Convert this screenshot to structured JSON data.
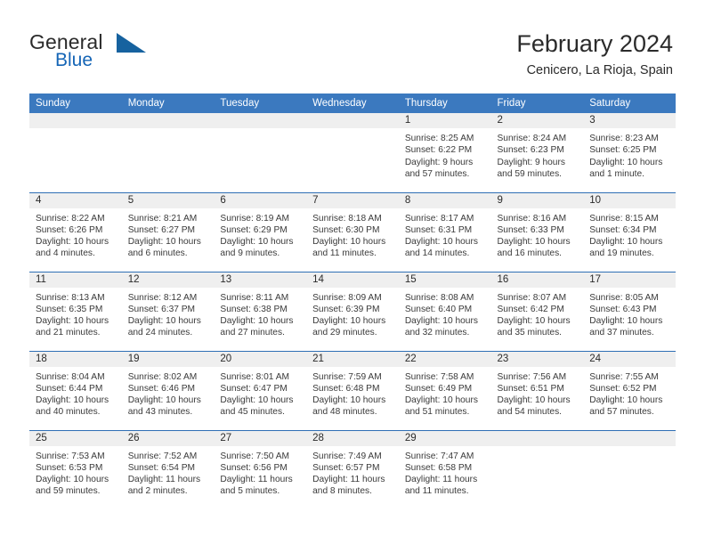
{
  "brand": {
    "name_top": "General",
    "name_bottom": "Blue",
    "logo_icon": "triangle-flag-icon",
    "accent_color": "#16629f"
  },
  "header": {
    "title": "February 2024",
    "location": "Cenicero, La Rioja, Spain"
  },
  "theme": {
    "header_blue": "#3b79bf",
    "row_divider_blue": "#2f6fb5",
    "daynum_band": "#efefef",
    "text": "#2b2b2b"
  },
  "weekday_headers": [
    "Sunday",
    "Monday",
    "Tuesday",
    "Wednesday",
    "Thursday",
    "Friday",
    "Saturday"
  ],
  "weeks": [
    [
      {
        "day": "",
        "empty": true,
        "sunrise": "",
        "sunset": "",
        "daylight_1": "",
        "daylight_2": ""
      },
      {
        "day": "",
        "empty": true,
        "sunrise": "",
        "sunset": "",
        "daylight_1": "",
        "daylight_2": ""
      },
      {
        "day": "",
        "empty": true,
        "sunrise": "",
        "sunset": "",
        "daylight_1": "",
        "daylight_2": ""
      },
      {
        "day": "",
        "empty": true,
        "sunrise": "",
        "sunset": "",
        "daylight_1": "",
        "daylight_2": ""
      },
      {
        "day": "1",
        "empty": false,
        "sunrise": "Sunrise: 8:25 AM",
        "sunset": "Sunset: 6:22 PM",
        "daylight_1": "Daylight: 9 hours",
        "daylight_2": "and 57 minutes."
      },
      {
        "day": "2",
        "empty": false,
        "sunrise": "Sunrise: 8:24 AM",
        "sunset": "Sunset: 6:23 PM",
        "daylight_1": "Daylight: 9 hours",
        "daylight_2": "and 59 minutes."
      },
      {
        "day": "3",
        "empty": false,
        "sunrise": "Sunrise: 8:23 AM",
        "sunset": "Sunset: 6:25 PM",
        "daylight_1": "Daylight: 10 hours",
        "daylight_2": "and 1 minute."
      }
    ],
    [
      {
        "day": "4",
        "empty": false,
        "sunrise": "Sunrise: 8:22 AM",
        "sunset": "Sunset: 6:26 PM",
        "daylight_1": "Daylight: 10 hours",
        "daylight_2": "and 4 minutes."
      },
      {
        "day": "5",
        "empty": false,
        "sunrise": "Sunrise: 8:21 AM",
        "sunset": "Sunset: 6:27 PM",
        "daylight_1": "Daylight: 10 hours",
        "daylight_2": "and 6 minutes."
      },
      {
        "day": "6",
        "empty": false,
        "sunrise": "Sunrise: 8:19 AM",
        "sunset": "Sunset: 6:29 PM",
        "daylight_1": "Daylight: 10 hours",
        "daylight_2": "and 9 minutes."
      },
      {
        "day": "7",
        "empty": false,
        "sunrise": "Sunrise: 8:18 AM",
        "sunset": "Sunset: 6:30 PM",
        "daylight_1": "Daylight: 10 hours",
        "daylight_2": "and 11 minutes."
      },
      {
        "day": "8",
        "empty": false,
        "sunrise": "Sunrise: 8:17 AM",
        "sunset": "Sunset: 6:31 PM",
        "daylight_1": "Daylight: 10 hours",
        "daylight_2": "and 14 minutes."
      },
      {
        "day": "9",
        "empty": false,
        "sunrise": "Sunrise: 8:16 AM",
        "sunset": "Sunset: 6:33 PM",
        "daylight_1": "Daylight: 10 hours",
        "daylight_2": "and 16 minutes."
      },
      {
        "day": "10",
        "empty": false,
        "sunrise": "Sunrise: 8:15 AM",
        "sunset": "Sunset: 6:34 PM",
        "daylight_1": "Daylight: 10 hours",
        "daylight_2": "and 19 minutes."
      }
    ],
    [
      {
        "day": "11",
        "empty": false,
        "sunrise": "Sunrise: 8:13 AM",
        "sunset": "Sunset: 6:35 PM",
        "daylight_1": "Daylight: 10 hours",
        "daylight_2": "and 21 minutes."
      },
      {
        "day": "12",
        "empty": false,
        "sunrise": "Sunrise: 8:12 AM",
        "sunset": "Sunset: 6:37 PM",
        "daylight_1": "Daylight: 10 hours",
        "daylight_2": "and 24 minutes."
      },
      {
        "day": "13",
        "empty": false,
        "sunrise": "Sunrise: 8:11 AM",
        "sunset": "Sunset: 6:38 PM",
        "daylight_1": "Daylight: 10 hours",
        "daylight_2": "and 27 minutes."
      },
      {
        "day": "14",
        "empty": false,
        "sunrise": "Sunrise: 8:09 AM",
        "sunset": "Sunset: 6:39 PM",
        "daylight_1": "Daylight: 10 hours",
        "daylight_2": "and 29 minutes."
      },
      {
        "day": "15",
        "empty": false,
        "sunrise": "Sunrise: 8:08 AM",
        "sunset": "Sunset: 6:40 PM",
        "daylight_1": "Daylight: 10 hours",
        "daylight_2": "and 32 minutes."
      },
      {
        "day": "16",
        "empty": false,
        "sunrise": "Sunrise: 8:07 AM",
        "sunset": "Sunset: 6:42 PM",
        "daylight_1": "Daylight: 10 hours",
        "daylight_2": "and 35 minutes."
      },
      {
        "day": "17",
        "empty": false,
        "sunrise": "Sunrise: 8:05 AM",
        "sunset": "Sunset: 6:43 PM",
        "daylight_1": "Daylight: 10 hours",
        "daylight_2": "and 37 minutes."
      }
    ],
    [
      {
        "day": "18",
        "empty": false,
        "sunrise": "Sunrise: 8:04 AM",
        "sunset": "Sunset: 6:44 PM",
        "daylight_1": "Daylight: 10 hours",
        "daylight_2": "and 40 minutes."
      },
      {
        "day": "19",
        "empty": false,
        "sunrise": "Sunrise: 8:02 AM",
        "sunset": "Sunset: 6:46 PM",
        "daylight_1": "Daylight: 10 hours",
        "daylight_2": "and 43 minutes."
      },
      {
        "day": "20",
        "empty": false,
        "sunrise": "Sunrise: 8:01 AM",
        "sunset": "Sunset: 6:47 PM",
        "daylight_1": "Daylight: 10 hours",
        "daylight_2": "and 45 minutes."
      },
      {
        "day": "21",
        "empty": false,
        "sunrise": "Sunrise: 7:59 AM",
        "sunset": "Sunset: 6:48 PM",
        "daylight_1": "Daylight: 10 hours",
        "daylight_2": "and 48 minutes."
      },
      {
        "day": "22",
        "empty": false,
        "sunrise": "Sunrise: 7:58 AM",
        "sunset": "Sunset: 6:49 PM",
        "daylight_1": "Daylight: 10 hours",
        "daylight_2": "and 51 minutes."
      },
      {
        "day": "23",
        "empty": false,
        "sunrise": "Sunrise: 7:56 AM",
        "sunset": "Sunset: 6:51 PM",
        "daylight_1": "Daylight: 10 hours",
        "daylight_2": "and 54 minutes."
      },
      {
        "day": "24",
        "empty": false,
        "sunrise": "Sunrise: 7:55 AM",
        "sunset": "Sunset: 6:52 PM",
        "daylight_1": "Daylight: 10 hours",
        "daylight_2": "and 57 minutes."
      }
    ],
    [
      {
        "day": "25",
        "empty": false,
        "sunrise": "Sunrise: 7:53 AM",
        "sunset": "Sunset: 6:53 PM",
        "daylight_1": "Daylight: 10 hours",
        "daylight_2": "and 59 minutes."
      },
      {
        "day": "26",
        "empty": false,
        "sunrise": "Sunrise: 7:52 AM",
        "sunset": "Sunset: 6:54 PM",
        "daylight_1": "Daylight: 11 hours",
        "daylight_2": "and 2 minutes."
      },
      {
        "day": "27",
        "empty": false,
        "sunrise": "Sunrise: 7:50 AM",
        "sunset": "Sunset: 6:56 PM",
        "daylight_1": "Daylight: 11 hours",
        "daylight_2": "and 5 minutes."
      },
      {
        "day": "28",
        "empty": false,
        "sunrise": "Sunrise: 7:49 AM",
        "sunset": "Sunset: 6:57 PM",
        "daylight_1": "Daylight: 11 hours",
        "daylight_2": "and 8 minutes."
      },
      {
        "day": "29",
        "empty": false,
        "sunrise": "Sunrise: 7:47 AM",
        "sunset": "Sunset: 6:58 PM",
        "daylight_1": "Daylight: 11 hours",
        "daylight_2": "and 11 minutes."
      },
      {
        "day": "",
        "empty": true,
        "sunrise": "",
        "sunset": "",
        "daylight_1": "",
        "daylight_2": ""
      },
      {
        "day": "",
        "empty": true,
        "sunrise": "",
        "sunset": "",
        "daylight_1": "",
        "daylight_2": ""
      }
    ]
  ]
}
